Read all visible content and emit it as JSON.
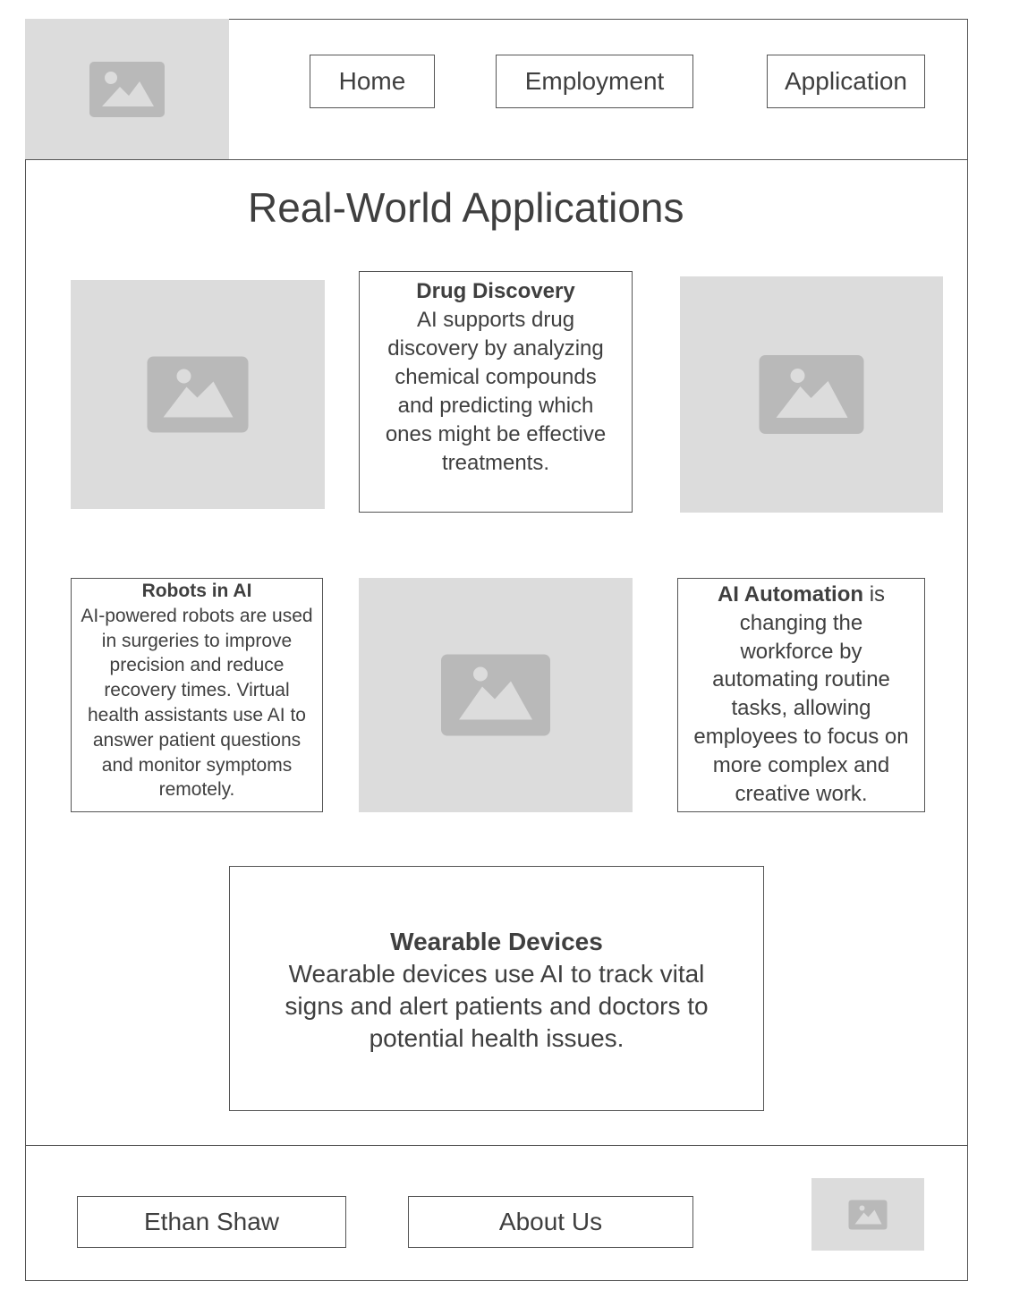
{
  "header": {
    "logo_icon": "image-placeholder-icon",
    "nav": [
      {
        "label": "Home"
      },
      {
        "label": "Employment"
      },
      {
        "label": "Application"
      }
    ]
  },
  "main": {
    "title": "Real-World Applications",
    "cards": {
      "drug": {
        "heading": "Drug Discovery",
        "text": "AI supports drug discovery by analyzing chemical compounds and predicting which ones might be effective treatments."
      },
      "robots": {
        "heading": "Robots in AI",
        "text": "AI-powered robots are used in surgeries to improve precision and reduce recovery times. Virtual health assistants use AI to answer patient questions and monitor symptoms remotely."
      },
      "automation": {
        "heading": "AI Automation",
        "text": " is changing the workforce by automating routine tasks, allowing employees to focus on more complex and creative work."
      },
      "wearable": {
        "heading": "Wearable Devices",
        "text": "Wearable devices use AI to track vital signs and alert patients and doctors to potential health issues."
      }
    },
    "image_icon": "image-placeholder-icon"
  },
  "footer": {
    "author": "Ethan Shaw",
    "about": "About Us",
    "logo_icon": "image-placeholder-icon"
  },
  "colors": {
    "placeholder_bg": "#dcdcdc",
    "placeholder_icon": "#b9b9b9",
    "border": "#555555",
    "text": "#3f3f3f"
  }
}
